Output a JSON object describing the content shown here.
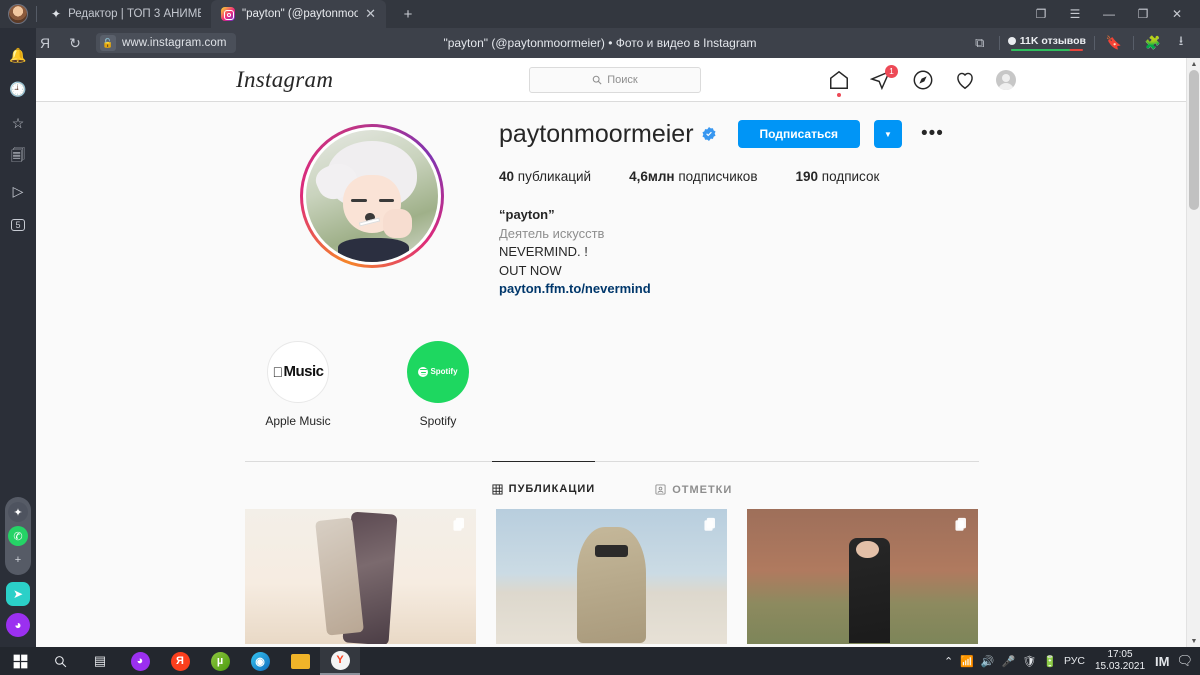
{
  "browser": {
    "tabs": [
      {
        "label": "Редактор | ТОП 3 АНИМЕ-",
        "icon": "sparkle-icon",
        "active": false
      },
      {
        "label": "\"payton\" (@paytonmoo",
        "icon": "instagram-favicon",
        "active": true
      }
    ],
    "new_tab_label": "+",
    "window_controls": {
      "collections": "❐",
      "menu": "☰",
      "minimize": "—",
      "maximize": "❐",
      "close": "✕"
    },
    "nav": {
      "back": "←",
      "yandex": "Я",
      "reload": "↻"
    },
    "url": "www.instagram.com",
    "lock_icon": "unlocked-padlock-icon",
    "page_title": "\"payton\" (@paytonmoormeier) • Фото и видео в Instagram",
    "reviews_label": "11K отзывов",
    "sidebar_icons": [
      "bell-icon",
      "history-clock-icon",
      "bookmarks-star-icon",
      "collections-icon",
      "video-player-icon",
      "downloads-5-icon"
    ],
    "sidebar_badge": "5",
    "messenger_icons": [
      "sparkle-icon",
      "whatsapp-icon",
      "add-service-icon",
      "telegram-icon",
      "alisa-icon"
    ]
  },
  "instagram": {
    "logo": "Instagram",
    "search": {
      "placeholder": "Поиск",
      "icon": "search-icon"
    },
    "nav": [
      {
        "name": "home-icon",
        "badge": ""
      },
      {
        "name": "direct-messages-icon",
        "badge": "1"
      },
      {
        "name": "explore-compass-icon",
        "badge": ""
      },
      {
        "name": "activity-heart-icon",
        "badge": ""
      },
      {
        "name": "profile-avatar-icon",
        "badge": ""
      }
    ],
    "profile": {
      "username": "paytonmoormeier",
      "verified_icon": "verified-badge-icon",
      "follow_button": "Подписаться",
      "dropdown_icon": "chevron-down-icon",
      "more_icon": "•••",
      "stats": [
        {
          "value": "40",
          "label": "публикаций"
        },
        {
          "value": "4,6млн",
          "label": "подписчиков"
        },
        {
          "value": "190",
          "label": "подписок"
        }
      ],
      "bio": {
        "name": "“payton”",
        "category": "Деятель искусств",
        "line1": "NEVERMIND. !",
        "line2": "OUT NOW",
        "link": "payton.ffm.to/nevermind"
      },
      "links": [
        {
          "label": "Apple Music",
          "icon": "apple-music-icon",
          "brand_text": "Music"
        },
        {
          "label": "Spotify",
          "icon": "spotify-icon",
          "brand_text": "Spotify"
        }
      ]
    },
    "tabs": [
      {
        "label": "ПУБЛИКАЦИИ",
        "icon": "grid-icon",
        "active": true
      },
      {
        "label": "ОТМЕТКИ",
        "icon": "tagged-person-icon",
        "active": false
      }
    ],
    "posts": [
      {
        "name": "post-thumbnail-1",
        "carousel_icon": "carousel-icon"
      },
      {
        "name": "post-thumbnail-2",
        "carousel_icon": "carousel-icon"
      },
      {
        "name": "post-thumbnail-3",
        "carousel_icon": "carousel-icon"
      }
    ]
  },
  "taskbar": {
    "start_icon": "windows-start-icon",
    "search_icon": "search-icon",
    "taskview_icon": "task-view-icon",
    "apps": [
      {
        "name": "alisa-icon",
        "glyph": ""
      },
      {
        "name": "yandex-icon",
        "glyph": "Я"
      },
      {
        "name": "utorrent-icon",
        "glyph": "µ"
      },
      {
        "name": "edge-icon",
        "glyph": ""
      },
      {
        "name": "file-explorer-icon",
        "glyph": ""
      },
      {
        "name": "yandex-browser-icon",
        "glyph": "Y",
        "active": true
      }
    ],
    "tray": {
      "chevron": "⌃",
      "wifi_icon": "wifi-icon",
      "volume_icon": "volume-icon",
      "mic_muted_icon": "mic-muted-icon",
      "security_icon": "security-icon",
      "battery_icon": "battery-icon",
      "language": "РУС",
      "time": "17:05",
      "date": "15.03.2021",
      "imo_icon": "imo-icon",
      "notifications_icon": "notifications-icon"
    }
  },
  "colors": {
    "instagram_blue": "#0095f6",
    "verified_blue": "#3897f0",
    "link_blue": "#00376b",
    "spotify_green": "#1ed760",
    "badge_red": "#ed4956",
    "chrome_dark": "#33373f"
  }
}
